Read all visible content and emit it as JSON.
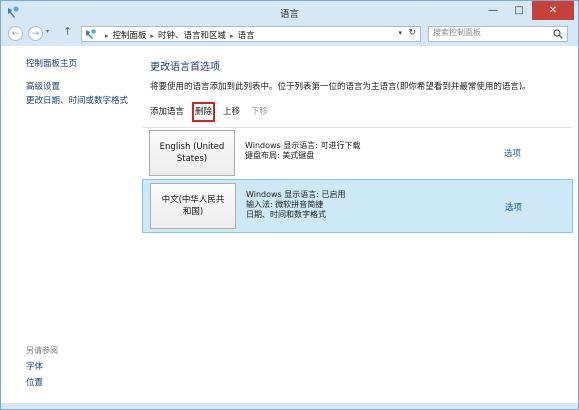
{
  "window": {
    "title": "语言",
    "minimize_glyph": "—",
    "maximize_glyph": "□",
    "close_glyph": "✕"
  },
  "nav": {
    "back_glyph": "←",
    "forward_glyph": "→",
    "up_glyph": "↑",
    "breadcrumb": [
      "控制面板",
      "时钟、语言和区域",
      "语言"
    ],
    "breadcrumb_sep": "▸",
    "dropdown_glyph": "▾",
    "refresh_glyph": "↻",
    "search_placeholder": "搜索控制面板"
  },
  "sidebar": {
    "home_link": "控制面板主页",
    "links": [
      "高级设置",
      "更改日期、时间或数字格式"
    ],
    "see_also_label": "另请参阅",
    "see_also_links": [
      "字体",
      "位置"
    ]
  },
  "main": {
    "heading": "更改语言首选项",
    "description": "将要使用的语言添加到此列表中。位于列表第一位的语言为主语言(即你希望看到并最常使用的语言)。",
    "toolbar": {
      "add": "添加语言",
      "remove": "删除",
      "move_up": "上移",
      "move_down": "下移"
    },
    "languages": [
      {
        "name_line1": "English (United",
        "name_line2": "States)",
        "info": [
          "Windows 显示语言: 可进行下载",
          "键盘布局: 美式键盘"
        ],
        "options": "选项"
      },
      {
        "name_line1": "中文(中华人民共",
        "name_line2": "和国)",
        "info": [
          "Windows 显示语言: 已启用",
          "输入法: 微软拼音简捷",
          "日期、时间和数字格式"
        ],
        "options": "选项"
      }
    ]
  },
  "colors": {
    "accent_link": "#1a64ab",
    "heading": "#1c3c84",
    "selection_bg": "#cde8f7",
    "selection_border": "#7ec6ea",
    "highlight_box": "#d2232a",
    "close_button": "#c6413a"
  }
}
